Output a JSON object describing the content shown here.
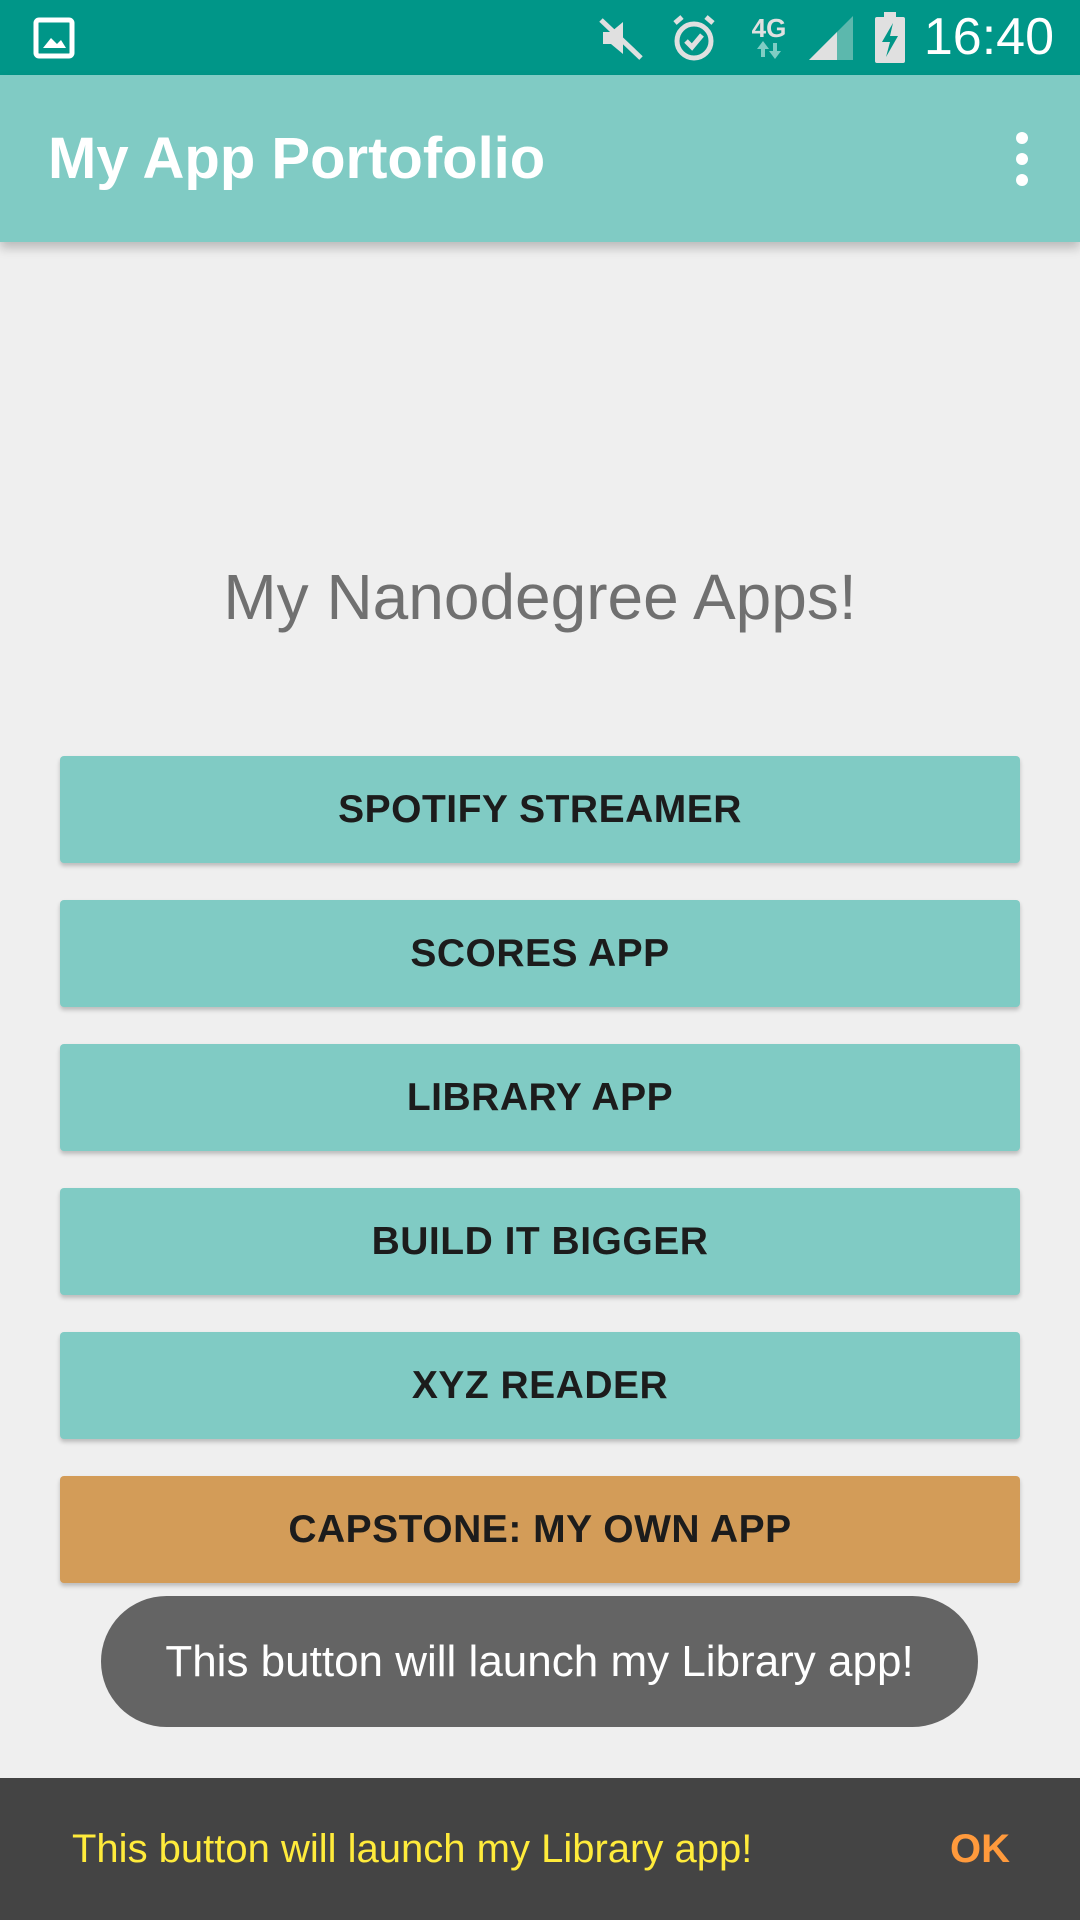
{
  "status_bar": {
    "time": "16:40",
    "network_type": "4G",
    "icons": [
      "gallery-notification-icon",
      "mute-icon",
      "alarm-icon",
      "network-4g-icon",
      "signal-icon",
      "battery-charging-icon"
    ]
  },
  "app_bar": {
    "title": "My App Portofolio",
    "overflow_icon": "more-vert-icon"
  },
  "main": {
    "heading": "My Nanodegree Apps!",
    "buttons": [
      {
        "label": "SPOTIFY STREAMER"
      },
      {
        "label": "SCORES APP"
      },
      {
        "label": "LIBRARY APP"
      },
      {
        "label": "BUILD IT BIGGER"
      },
      {
        "label": "XYZ READER"
      },
      {
        "label": "CAPSTONE: MY OWN APP"
      }
    ]
  },
  "toast": {
    "text": "This button will launch my Library app!"
  },
  "snackbar": {
    "text": "This button will launch my Library app!",
    "action": "OK"
  },
  "colors": {
    "status_bar": "#009688",
    "app_bar": "#80cbc4",
    "button": "#80cbc4",
    "capstone_button": "#d39c58",
    "toast": "#646464",
    "snackbar": "#444444",
    "snackbar_text": "#ffeb3b",
    "snackbar_action": "#ff9a3c"
  }
}
